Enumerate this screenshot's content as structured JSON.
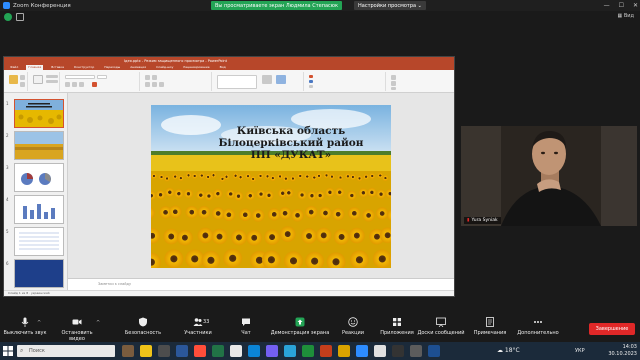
{
  "zoom": {
    "title": "Zoom Конференция",
    "share_banner": "Вы просматриваете экран Людмила Степасюк",
    "view_settings": "Настройки просмотра",
    "top_right": "Вид",
    "accent": "#2d8cff"
  },
  "ppt": {
    "title": "Ідея.pptx - Режим защищенного просмотра - PowerPoint",
    "tabs": [
      "Файл",
      "Главная",
      "Вставка",
      "Конструктор",
      "Переходы",
      "Анимация",
      "Слайд-шоу",
      "Рецензирование",
      "Вид"
    ],
    "active_tab": 1,
    "notes_placeholder": "Заметки к слайду",
    "status": "Слайд 1 из 8  ·  украинский",
    "slide_numbers": [
      "1",
      "2",
      "3",
      "4",
      "5",
      "6"
    ],
    "slide": {
      "line1": "Київська область",
      "line2": "Білоцерківський  район",
      "line3": "ПП «ДУКАТ»"
    }
  },
  "participant": {
    "name": "Yura Syniak"
  },
  "toolbar": {
    "mute": "Выключить звук",
    "video": "Остановить видео",
    "security": "Безопасность",
    "participants": "Участники",
    "participants_count": "33",
    "chat": "Чат",
    "share": "Демонстрация экрана",
    "reactions": "Реакции",
    "apps": "Приложения",
    "whiteboard": "Доски сообщений",
    "notes": "Примечания",
    "more": "Дополнительно",
    "end": "Завершение",
    "share_color": "#23a455",
    "end_color": "#e02828"
  },
  "taskbar": {
    "search_placeholder": "Поиск",
    "weather": "18°C",
    "lang": "УКР",
    "time": "14:03",
    "date": "30.10.2023"
  }
}
